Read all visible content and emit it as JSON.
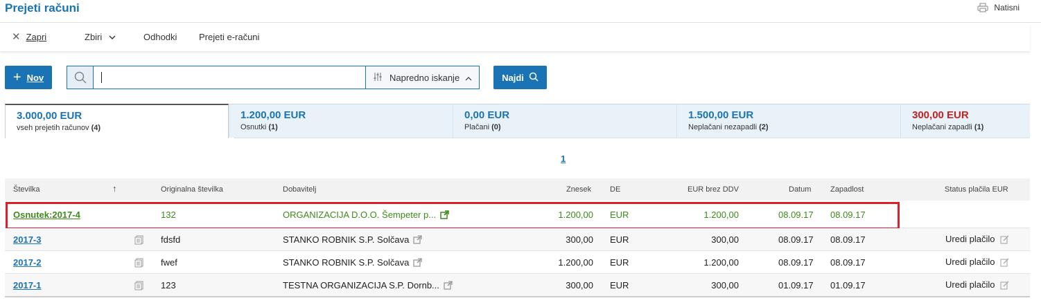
{
  "header": {
    "title": "Prejeti računi",
    "print_label": "Natisni"
  },
  "menu": {
    "close_label": "Zapri",
    "zbiri_label": "Zbiri",
    "odhodki_label": "Odhodki",
    "erac_label": "Prejeti e-računi"
  },
  "toolbar": {
    "new_label": "Nov",
    "search_value": "",
    "advanced_label": "Napredno iskanje",
    "find_label": "Najdi"
  },
  "tabs": [
    {
      "amount": "3.000,00 EUR",
      "label": "vseh prejetih računov",
      "count": "(4)"
    },
    {
      "amount": "1.200,00 EUR",
      "label": "Osnutki",
      "count": "(1)"
    },
    {
      "amount": "0,00 EUR",
      "label": "Plačani",
      "count": "(0)"
    },
    {
      "amount": "1.500,00 EUR",
      "label": "Neplačani nezapadli",
      "count": "(2)"
    },
    {
      "amount": "300,00 EUR",
      "label": "Neplačani zapadli",
      "count": "(1)"
    }
  ],
  "pager": {
    "page": "1"
  },
  "table": {
    "columns": {
      "stevilka": "Številka",
      "sort_arrow": "↑",
      "orig": "Originalna številka",
      "dobavitelj": "Dobavitelj",
      "znesek": "Znesek",
      "de": "DE",
      "eur_brez": "EUR brez DDV",
      "datum": "Datum",
      "zapadlost": "Zapadlost",
      "status": "Status plačila EUR"
    },
    "rows": [
      {
        "stevilka": "Osnutek:2017-4",
        "orig": "132",
        "dobavitelj": "ORGANIZACIJA D.O.O. Šempeter p...",
        "znesek": "1.200,00",
        "de": "EUR",
        "eur_brez": "1.200,00",
        "datum": "08.09.17",
        "zapadlost": "08.09.17",
        "status": ""
      },
      {
        "stevilka": "2017-3",
        "orig": "fdsfd",
        "dobavitelj": "STANKO ROBNIK S.P. Solčava",
        "znesek": "300,00",
        "de": "EUR",
        "eur_brez": "300,00",
        "datum": "08.09.17",
        "zapadlost": "08.09.17",
        "status": "Uredi plačilo"
      },
      {
        "stevilka": "2017-2",
        "orig": "fwef",
        "dobavitelj": "STANKO ROBNIK S.P. Solčava",
        "znesek": "1.200,00",
        "de": "EUR",
        "eur_brez": "1.200,00",
        "datum": "08.09.17",
        "zapadlost": "08.09.17",
        "status": "Uredi plačilo"
      },
      {
        "stevilka": "2017-1",
        "orig": "123",
        "dobavitelj": "TESTNA ORGANIZACIJA S.P. Dornb...",
        "znesek": "300,00",
        "de": "EUR",
        "eur_brez": "300,00",
        "datum": "01.09.17",
        "zapadlost": "01.09.17",
        "status": "Uredi plačilo"
      }
    ]
  },
  "colors": {
    "accent": "#1a73b5",
    "draft_green": "#3d8a1a",
    "overdue_red": "#c62020",
    "highlight_red": "#d9202b"
  }
}
